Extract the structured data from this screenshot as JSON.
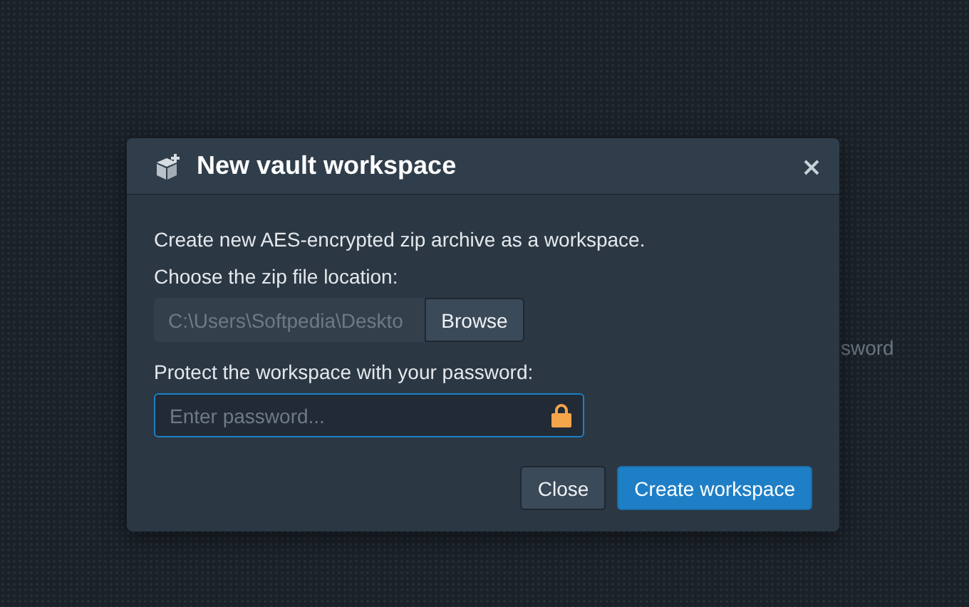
{
  "background": {
    "text": "sword"
  },
  "dialog": {
    "title": "New vault workspace",
    "description": "Create new AES-encrypted zip archive as a workspace.",
    "location_label": "Choose the zip file location:",
    "location_field": {
      "value": "C:\\Users\\Softpedia\\Deskto"
    },
    "browse_button": "Browse",
    "password_label": "Protect the workspace with your password:",
    "password_field": {
      "placeholder": "Enter password..."
    },
    "buttons": [
      {
        "label": "Close",
        "kind": "secondary"
      },
      {
        "label": "Create workspace",
        "kind": "primary"
      }
    ]
  }
}
